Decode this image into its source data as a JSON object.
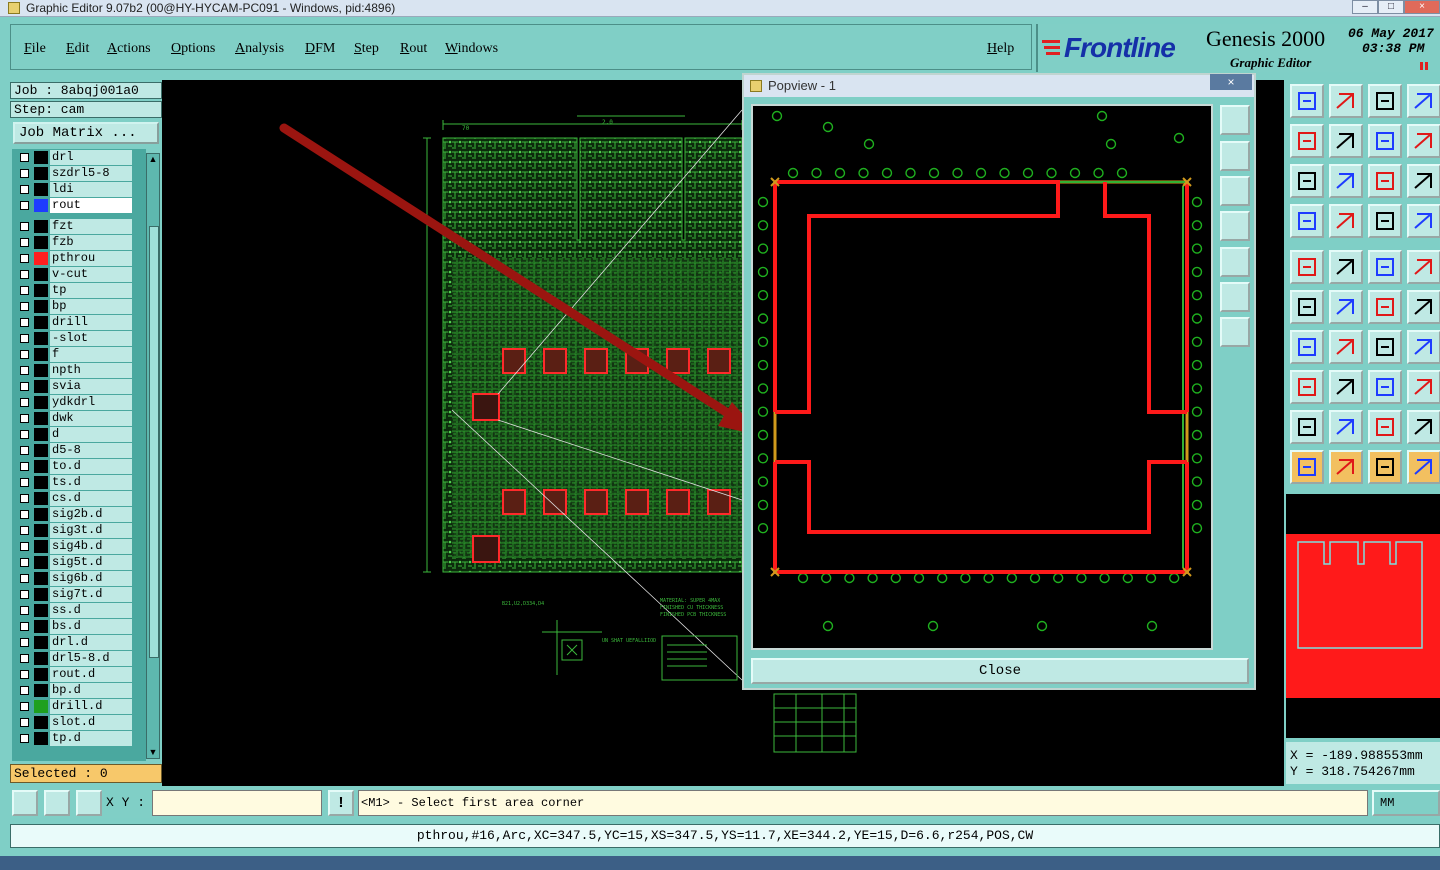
{
  "window": {
    "title": "Graphic Editor 9.07b2 (00@HY-HYCAM-PC091 - Windows, pid:4896)",
    "controls": [
      "–",
      "□",
      "×"
    ]
  },
  "menu": {
    "items": [
      "File",
      "Edit",
      "Actions",
      "Options",
      "Analysis",
      "DFM",
      "Step",
      "Rout",
      "Windows"
    ],
    "help": "Help"
  },
  "brand": {
    "logo": "Frontline",
    "product": "Genesis 2000",
    "subtitle": "Graphic Editor",
    "date": "06 May 2017",
    "time": "03:38 PM"
  },
  "job": {
    "job_label": "Job : 8abqj001a0",
    "step_label": "Step: cam",
    "matrix_button": "Job Matrix ..."
  },
  "layers": [
    {
      "name": "drl",
      "color": "#000000",
      "active": false
    },
    {
      "name": "szdrl5-8",
      "color": "#000000",
      "active": false
    },
    {
      "name": "ldi",
      "color": "#000000",
      "active": false
    },
    {
      "name": "rout",
      "color": "#1e3cff",
      "active": true
    },
    {
      "name": "fzt",
      "color": "#000000",
      "active": false
    },
    {
      "name": "fzb",
      "color": "#000000",
      "active": false
    },
    {
      "name": "pthrou",
      "color": "#ff2020",
      "active": false
    },
    {
      "name": "v-cut",
      "color": "#000000",
      "active": false
    },
    {
      "name": "tp",
      "color": "#000000",
      "active": false
    },
    {
      "name": "bp",
      "color": "#000000",
      "active": false
    },
    {
      "name": "drill",
      "color": "#000000",
      "active": false
    },
    {
      "name": "-slot",
      "color": "#000000",
      "active": false
    },
    {
      "name": "f",
      "color": "#000000",
      "active": false
    },
    {
      "name": "npth",
      "color": "#000000",
      "active": false
    },
    {
      "name": "svia",
      "color": "#000000",
      "active": false
    },
    {
      "name": "ydkdrl",
      "color": "#000000",
      "active": false
    },
    {
      "name": "dwk",
      "color": "#000000",
      "active": false
    },
    {
      "name": "d",
      "color": "#000000",
      "active": false
    },
    {
      "name": "d5-8",
      "color": "#000000",
      "active": false
    },
    {
      "name": "to.d",
      "color": "#000000",
      "active": false
    },
    {
      "name": "ts.d",
      "color": "#000000",
      "active": false
    },
    {
      "name": "cs.d",
      "color": "#000000",
      "active": false
    },
    {
      "name": "sig2b.d",
      "color": "#000000",
      "active": false
    },
    {
      "name": "sig3t.d",
      "color": "#000000",
      "active": false
    },
    {
      "name": "sig4b.d",
      "color": "#000000",
      "active": false
    },
    {
      "name": "sig5t.d",
      "color": "#000000",
      "active": false
    },
    {
      "name": "sig6b.d",
      "color": "#000000",
      "active": false
    },
    {
      "name": "sig7t.d",
      "color": "#000000",
      "active": false
    },
    {
      "name": "ss.d",
      "color": "#000000",
      "active": false
    },
    {
      "name": "bs.d",
      "color": "#000000",
      "active": false
    },
    {
      "name": "drl.d",
      "color": "#000000",
      "active": false
    },
    {
      "name": "drl5-8.d",
      "color": "#000000",
      "active": false
    },
    {
      "name": "rout.d",
      "color": "#000000",
      "active": false
    },
    {
      "name": "bp.d",
      "color": "#000000",
      "active": false
    },
    {
      "name": "drill.d",
      "color": "#1fa01f",
      "active": false
    },
    {
      "name": "slot.d",
      "color": "#000000",
      "active": false
    },
    {
      "name": "tp.d",
      "color": "#000000",
      "active": false
    }
  ],
  "selected_label": "Selected : 0",
  "popview": {
    "title": "Popview - 1",
    "close_label": "Close",
    "x_label": "×"
  },
  "coords": {
    "x": "X = -189.988553mm",
    "y": "Y =  318.754267mm"
  },
  "command": {
    "xy_label": "X Y :",
    "prompt": "<M1> - Select first area corner",
    "units": "MM",
    "input_value": ""
  },
  "status_line": "pthrou,#16,Arc,XC=347.5,YC=15,XS=347.5,YS=11.7,XE=344.2,YE=15,D=6.6,r254,POS,CW",
  "colors": {
    "panel": "#7fcfc6",
    "field": "#bfe9e4",
    "copper": "#2fa82f",
    "rout": "#ff1a1a",
    "profile": "#d19a1c"
  }
}
